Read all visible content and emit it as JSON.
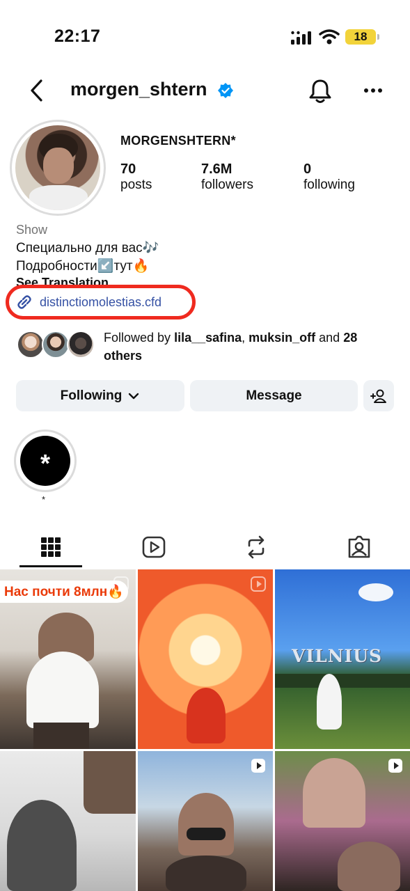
{
  "status_bar": {
    "time": "22:17",
    "battery": "18"
  },
  "header": {
    "username": "morgen_shtern"
  },
  "profile": {
    "full_name": "MORGENSHTERN*",
    "stats": [
      {
        "value": "70",
        "label": "posts"
      },
      {
        "value": "7.6M",
        "label": "followers"
      },
      {
        "value": "0",
        "label": "following"
      }
    ],
    "category": "Show",
    "bio_line1": "Специально для вас🎶",
    "bio_line2": "Подробности↙️тут🔥",
    "see_translation": "See Translation",
    "link": "distinctiomolestias.cfd"
  },
  "followed_by": {
    "prefix": "Followed by ",
    "user1": "lila__safina",
    "sep": ", ",
    "user2": "muksin_off",
    "and": " and ",
    "others": "28 others"
  },
  "buttons": {
    "following": "Following",
    "message": "Message"
  },
  "highlight": {
    "symbol": "*",
    "label": "*"
  },
  "tabs": [
    "grid-icon",
    "reels-icon",
    "reposts-icon",
    "tagged-icon"
  ],
  "grid": {
    "tile1_caption": "Нас почти 8млн🔥",
    "tile3_sign": "VILNIUS"
  },
  "colors": {
    "link": "#3551a4",
    "highlight_border": "#ef2a1f",
    "verified": "#0095f6",
    "caption": "#ea3a09"
  }
}
